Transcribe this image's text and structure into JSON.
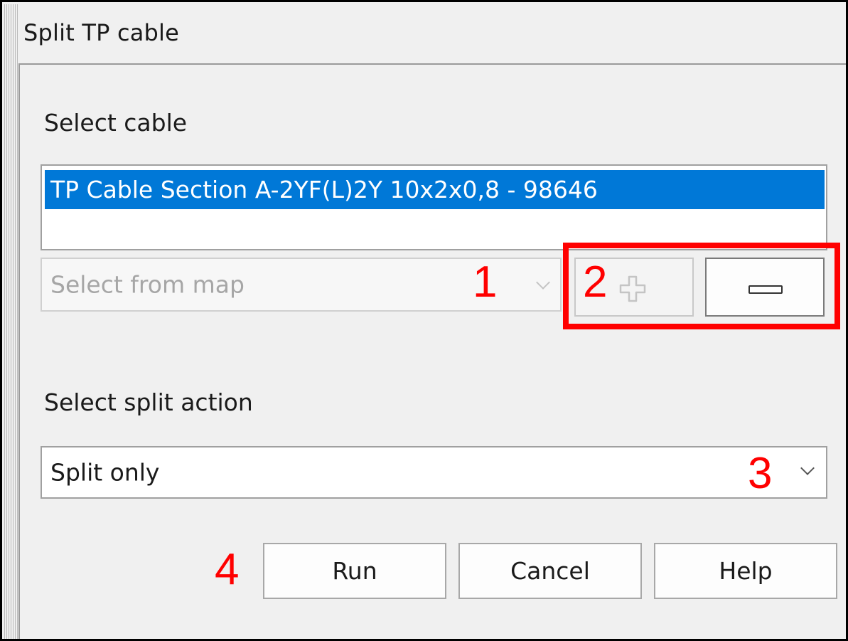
{
  "window": {
    "title": "Split TP cable"
  },
  "cable_section": {
    "label": "Select cable",
    "items": [
      "TP Cable Section A-2YF(L)2Y 10x2x0,8 - 98646"
    ],
    "selected_index": 0
  },
  "select_from_map": {
    "placeholder": "Select from map",
    "enabled": false
  },
  "add_button": {
    "icon": "plus-icon",
    "enabled": false
  },
  "remove_button": {
    "icon": "minus-icon",
    "enabled": true
  },
  "split_action": {
    "label": "Select split action",
    "value": "Split only"
  },
  "buttons": {
    "run": "Run",
    "cancel": "Cancel",
    "help": "Help"
  },
  "annotations": {
    "callouts": [
      "1",
      "2",
      "3",
      "4"
    ],
    "color": "#ff0000"
  },
  "colors": {
    "selection": "#0078d7",
    "background": "#f0f0f0"
  }
}
